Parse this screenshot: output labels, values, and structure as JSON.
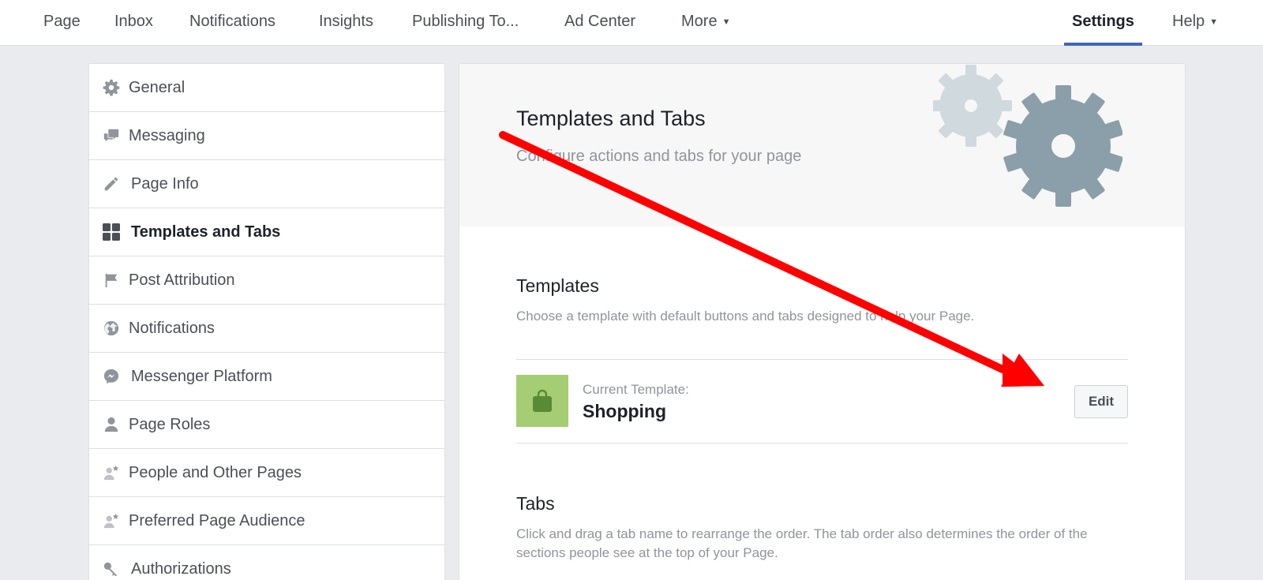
{
  "topnav": {
    "items": [
      {
        "label": "Page"
      },
      {
        "label": "Inbox"
      },
      {
        "label": "Notifications"
      },
      {
        "label": "Insights"
      },
      {
        "label": "Publishing To..."
      },
      {
        "label": "Ad Center"
      },
      {
        "label": "More"
      },
      {
        "label": "Settings",
        "active": true
      },
      {
        "label": "Help"
      }
    ]
  },
  "sidebar": {
    "items": [
      {
        "label": "General",
        "icon": "gear-icon"
      },
      {
        "label": "Messaging",
        "icon": "chat-bubbles-icon"
      },
      {
        "label": "Page Info",
        "icon": "pencil-icon"
      },
      {
        "label": "Templates and Tabs",
        "icon": "grid-icon",
        "active": true
      },
      {
        "label": "Post Attribution",
        "icon": "flag-icon"
      },
      {
        "label": "Notifications",
        "icon": "globe-icon"
      },
      {
        "label": "Messenger Platform",
        "icon": "messenger-icon"
      },
      {
        "label": "Page Roles",
        "icon": "person-icon"
      },
      {
        "label": "People and Other Pages",
        "icon": "person-star-icon"
      },
      {
        "label": "Preferred Page Audience",
        "icon": "person-star-icon"
      },
      {
        "label": "Authorizations",
        "icon": "key-icon"
      }
    ]
  },
  "main": {
    "hero": {
      "title": "Templates and Tabs",
      "subtitle": "Configure actions and tabs for your page"
    },
    "templates": {
      "title": "Templates",
      "description": "Choose a template with default buttons and tabs designed to help your Page.",
      "current_label": "Current Template:",
      "current_name": "Shopping",
      "edit_label": "Edit"
    },
    "tabs": {
      "title": "Tabs",
      "description": "Click and drag a tab name to rearrange the order. The tab order also determines the order of the sections people see at the top of your Page."
    }
  },
  "colors": {
    "accent": "#4267b2",
    "annotation_arrow": "#ff0000",
    "template_thumb": "#a5cd74",
    "gear_light": "#d0d9de",
    "gear_dark": "#8a9fa9"
  }
}
